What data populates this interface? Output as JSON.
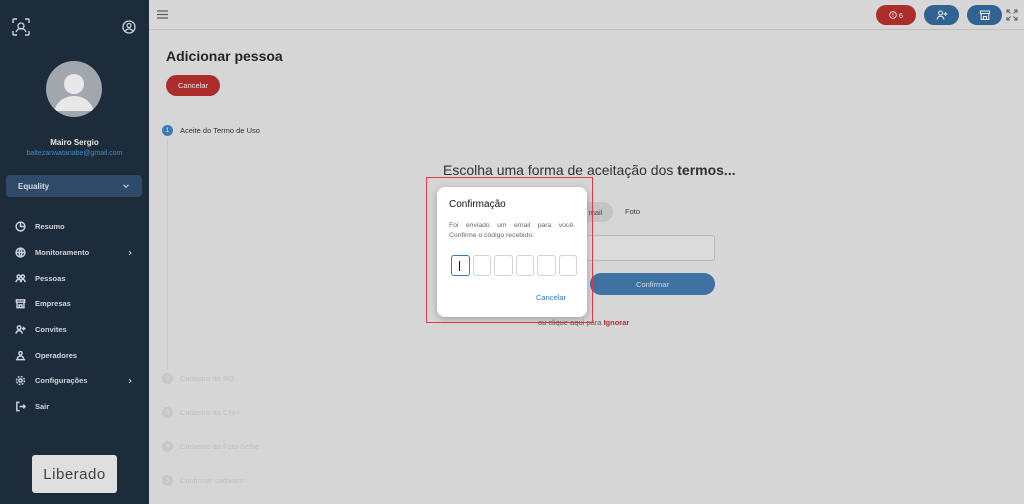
{
  "sidebar": {
    "user_name": "Mairo Sergio",
    "user_email": "baltezanwatanabe@gmail.com",
    "org_selected": "Equality",
    "items": [
      {
        "label": "Resumo",
        "icon": "chart-pie-icon"
      },
      {
        "label": "Monitoramento",
        "icon": "globe-icon",
        "has_arrow": true
      },
      {
        "label": "Pessoas",
        "icon": "people-icon"
      },
      {
        "label": "Empresas",
        "icon": "store-icon"
      },
      {
        "label": "Convites",
        "icon": "add-user-icon"
      },
      {
        "label": "Operadores",
        "icon": "operators-icon"
      },
      {
        "label": "Configurações",
        "icon": "gear-icon",
        "has_arrow": true
      },
      {
        "label": "Sair",
        "icon": "logout-icon"
      }
    ],
    "brand": "Liberado"
  },
  "topbar": {
    "alert_count": "6"
  },
  "main": {
    "title": "Adicionar pessoa",
    "cancel_label": "Cancelar",
    "steps": [
      {
        "num": "1",
        "label": "Aceite do Termo de Uso"
      },
      {
        "num": "2",
        "label": "Cadastro do RG"
      },
      {
        "num": "3",
        "label": "Cadastro da CNH"
      },
      {
        "num": "4",
        "label": "Cadastro da Foto Selfie"
      },
      {
        "num": "5",
        "label": "Confirmar cadastro"
      }
    ],
    "choose_prefix": "Escolha uma forma de aceitação dos ",
    "choose_bold": "termos...",
    "opt_email": "mail",
    "opt_foto": "Foto",
    "confirm_label": "Confirmar",
    "ignore_prefix": "ou clique aqui para ",
    "ignore_link": "Ignorar"
  },
  "modal": {
    "title": "Confirmação",
    "message": "Foi enviado um email para você. Confirme o código recebido.",
    "cancel_label": "Cancelar"
  },
  "colors": {
    "sidebar_bg": "#071a2c",
    "accent_blue": "#2e7bc4",
    "danger_red": "#b81c1c",
    "highlight": "#e23a4b"
  }
}
